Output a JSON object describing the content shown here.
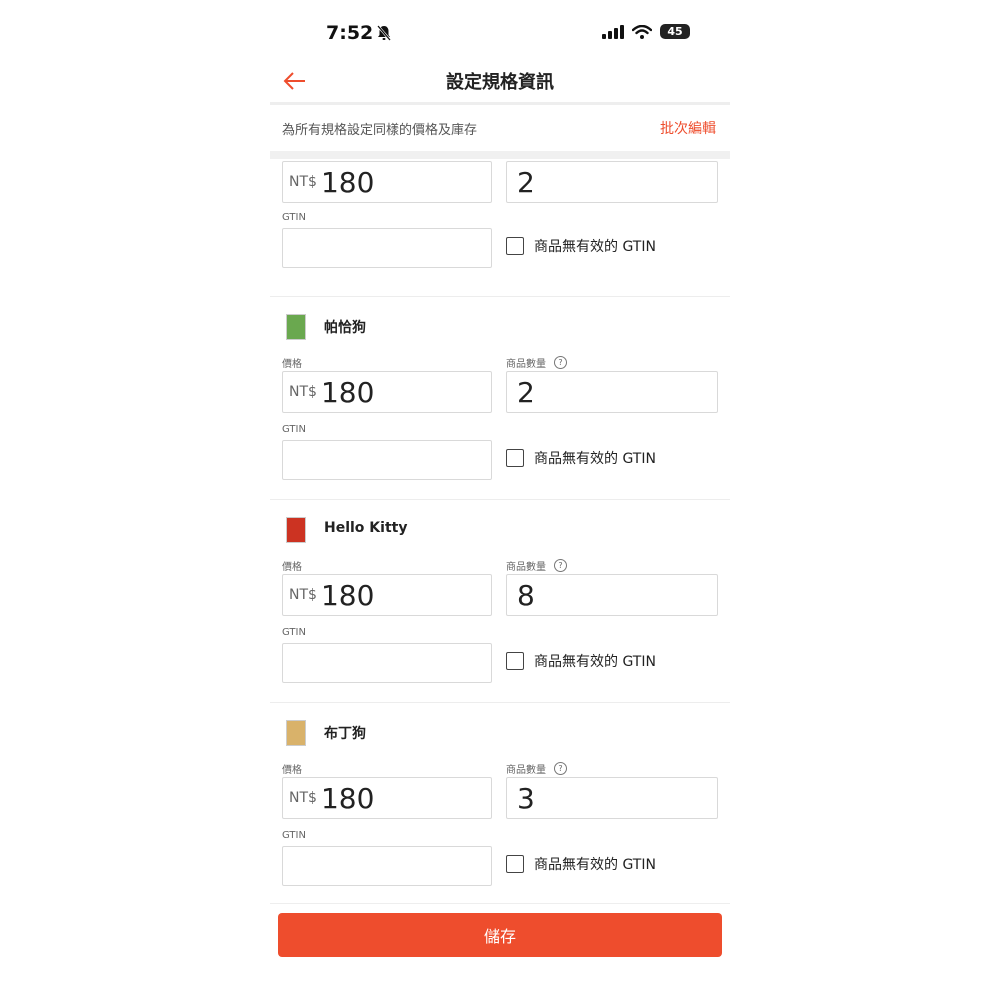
{
  "status": {
    "time": "7:52",
    "battery": "45"
  },
  "header": {
    "title": "設定規格資訊"
  },
  "batch": {
    "text": "為所有規格設定同樣的價格及庫存",
    "edit_label": "批次編輯"
  },
  "labels": {
    "price": "價格",
    "quantity": "商品數量",
    "help": "?",
    "gtin": "GTIN",
    "currency": "NT$",
    "no_gtin": "商品無有效的 GTIN"
  },
  "variants": [
    {
      "name": "",
      "price": "180",
      "quantity": "2",
      "gtin": ""
    },
    {
      "name": "帕恰狗",
      "price": "180",
      "quantity": "2",
      "gtin": "",
      "thumb_color": "#6aa84f"
    },
    {
      "name": "Hello Kitty",
      "price": "180",
      "quantity": "8",
      "gtin": "",
      "thumb_color": "#cc3322"
    },
    {
      "name": "布丁狗",
      "price": "180",
      "quantity": "3",
      "gtin": "",
      "thumb_color": "#d9b26a"
    }
  ],
  "footer": {
    "save_label": "儲存"
  },
  "colors": {
    "accent": "#ee4d2d"
  }
}
